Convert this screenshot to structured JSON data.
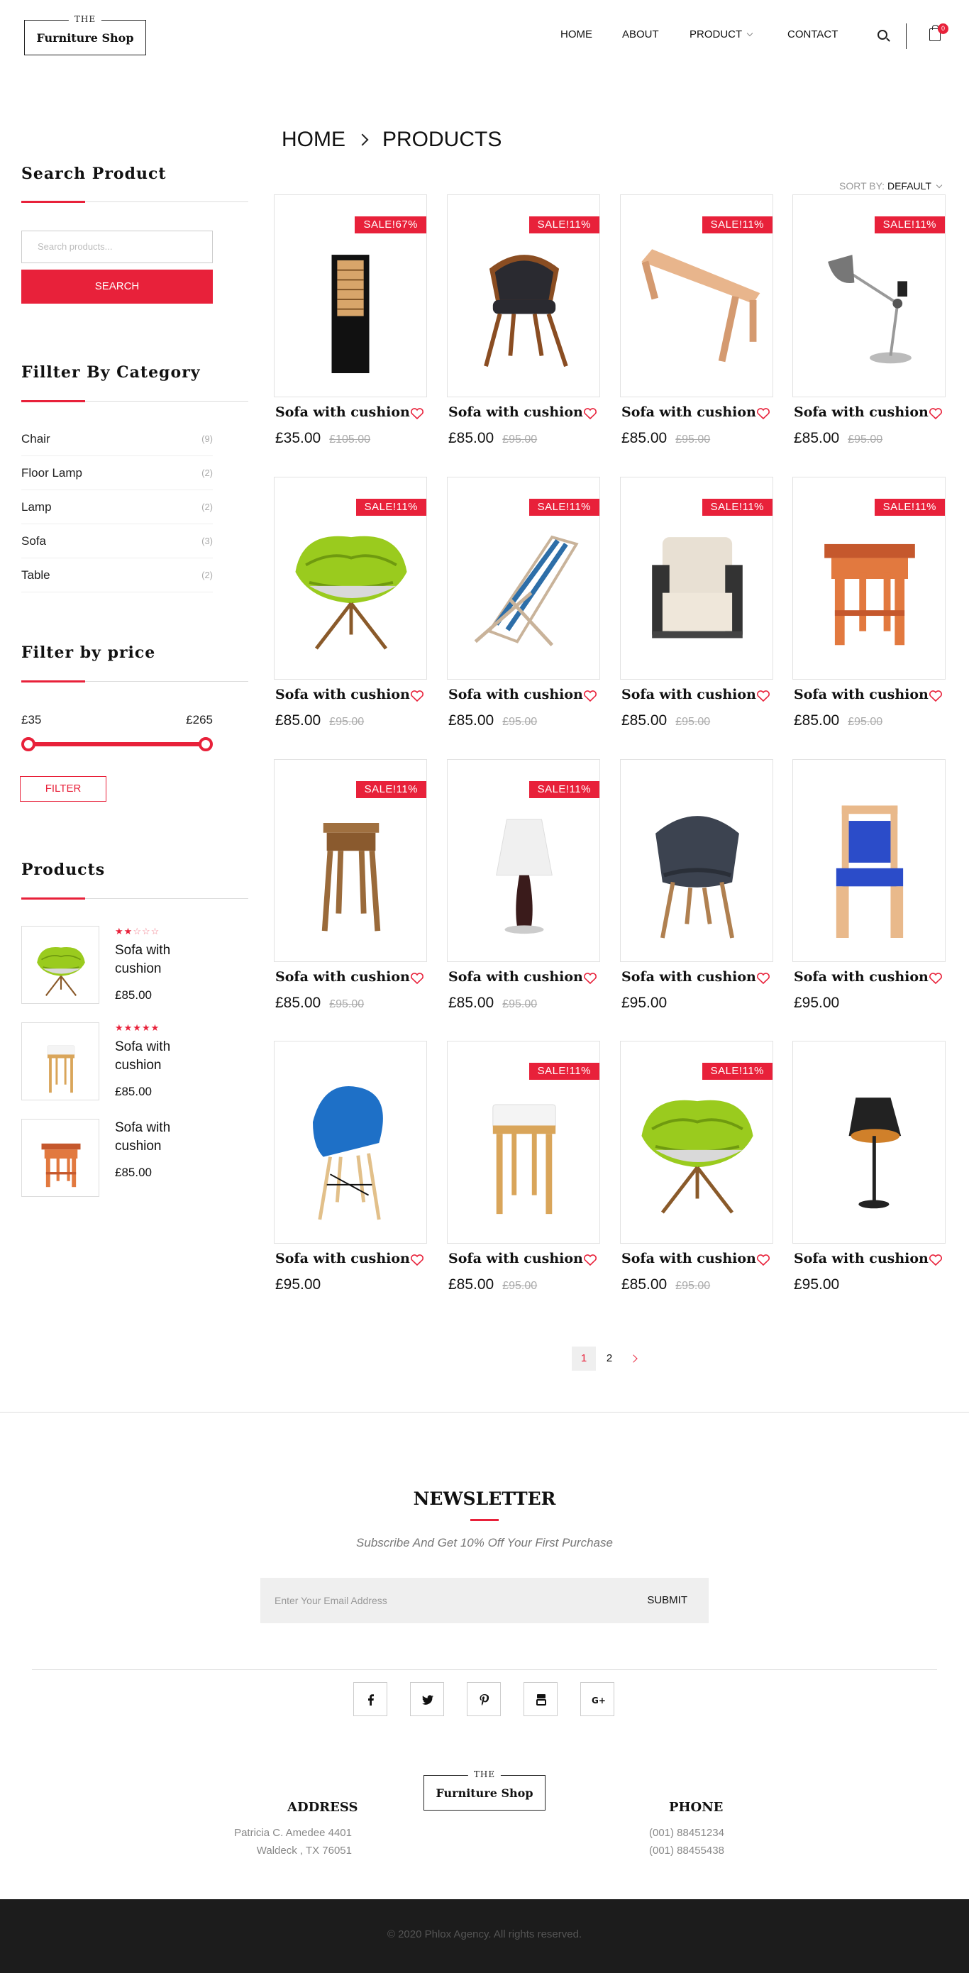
{
  "brand": {
    "the": "THE",
    "name": "Furniture Shop"
  },
  "nav": {
    "home": "HOME",
    "about": "ABOUT",
    "product": "PRODUCT",
    "contact": "CONTACT",
    "cart_count": "0"
  },
  "breadcrumb": {
    "home": "HOME",
    "current": "PRODUCTS"
  },
  "sidebar": {
    "search_title": "Search Product",
    "search_placeholder": "Search products...",
    "search_button": "SEARCH",
    "category_title": "Fillter By Category",
    "categories": [
      {
        "label": "Chair",
        "count": "(9)"
      },
      {
        "label": "Floor Lamp",
        "count": "(2)"
      },
      {
        "label": "Lamp",
        "count": "(2)"
      },
      {
        "label": "Sofa",
        "count": "(3)"
      },
      {
        "label": "Table",
        "count": "(2)"
      }
    ],
    "price_title": "Filter by price",
    "price_min": "£35",
    "price_max": "£265",
    "filter_button": "FILTER",
    "products_title": "Products",
    "products": [
      {
        "name": "Sofa with cushion",
        "price": "£85.00",
        "rating": 2
      },
      {
        "name": "Sofa with cushion",
        "price": "£85.00",
        "rating": 5
      },
      {
        "name": "Sofa with cushion",
        "price": "£85.00",
        "rating": 0
      }
    ]
  },
  "sort": {
    "label": "SORT BY:",
    "value": "DEFAULT"
  },
  "products": [
    {
      "title": "Sofa with cushion",
      "price": "£35.00",
      "old": "£105.00",
      "badge": "SALE!67%",
      "img": "pillar-lamp"
    },
    {
      "title": "Sofa with cushion",
      "price": "£85.00",
      "old": "£95.00",
      "badge": "SALE!11%",
      "img": "leather-chair"
    },
    {
      "title": "Sofa with cushion",
      "price": "£85.00",
      "old": "£95.00",
      "badge": "SALE!11%",
      "img": "wood-bench"
    },
    {
      "title": "Sofa with cushion",
      "price": "£85.00",
      "old": "£95.00",
      "badge": "SALE!11%",
      "img": "desk-lamp"
    },
    {
      "title": "Sofa with cushion",
      "price": "£85.00",
      "old": "£95.00",
      "badge": "SALE!11%",
      "img": "green-lounge"
    },
    {
      "title": "Sofa with cushion",
      "price": "£85.00",
      "old": "£95.00",
      "badge": "SALE!11%",
      "img": "deck-chair"
    },
    {
      "title": "Sofa with cushion",
      "price": "£85.00",
      "old": "£95.00",
      "badge": "SALE!11%",
      "img": "armchair"
    },
    {
      "title": "Sofa with cushion",
      "price": "£85.00",
      "old": "£95.00",
      "badge": "SALE!11%",
      "img": "side-table"
    },
    {
      "title": "Sofa with cushion",
      "price": "£85.00",
      "old": "£95.00",
      "badge": "SALE!11%",
      "img": "plant-stand"
    },
    {
      "title": "Sofa with cushion",
      "price": "£85.00",
      "old": "£95.00",
      "badge": "SALE!11%",
      "img": "table-lamp"
    },
    {
      "title": "Sofa with cushion",
      "price": "£95.00",
      "old": "",
      "badge": "",
      "img": "grey-chair"
    },
    {
      "title": "Sofa with cushion",
      "price": "£95.00",
      "old": "",
      "badge": "",
      "img": "blue-chair"
    },
    {
      "title": "Sofa with cushion",
      "price": "£95.00",
      "old": "",
      "badge": "",
      "img": "eames-chair"
    },
    {
      "title": "Sofa with cushion",
      "price": "£85.00",
      "old": "£95.00",
      "badge": "SALE!11%",
      "img": "stool"
    },
    {
      "title": "Sofa with cushion",
      "price": "£85.00",
      "old": "£95.00",
      "badge": "SALE!11%",
      "img": "green-lounge"
    },
    {
      "title": "Sofa with cushion",
      "price": "£95.00",
      "old": "",
      "badge": "",
      "img": "black-lamp"
    }
  ],
  "pagination": {
    "pages": [
      "1",
      "2"
    ],
    "current": "1"
  },
  "newsletter": {
    "title": "NEWSLETTER",
    "subtitle": "Subscribe And Get 10% Off Your First Purchase",
    "placeholder": "Enter Your Email Address",
    "button": "SUBMIT"
  },
  "social": [
    "facebook-icon",
    "twitter-icon",
    "pinterest-icon",
    "youtube-icon",
    "google-plus-icon"
  ],
  "footer": {
    "address_title": "ADDRESS",
    "address_line1": "Patricia C. Amedee 4401",
    "address_line2": "Waldeck , TX 76051",
    "phone_title": "PHONE",
    "phone1": "(001) 88451234",
    "phone2": "(001) 88455438",
    "copyright": "© 2020 Phlox Agency. All rights reserved."
  },
  "colors": {
    "accent": "#e8213a",
    "footer_bg": "#1c1c1c"
  }
}
